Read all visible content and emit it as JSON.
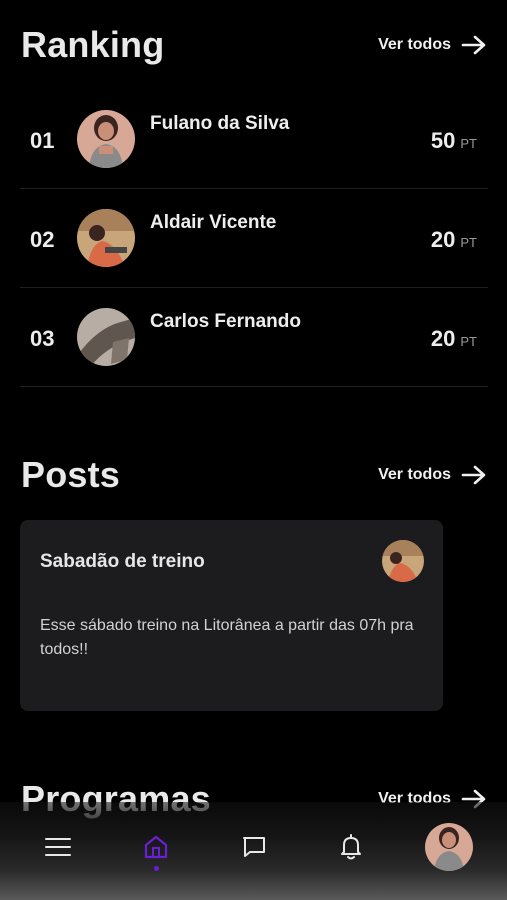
{
  "ranking": {
    "title": "Ranking",
    "see_all": "Ver todos",
    "items": [
      {
        "position": "01",
        "name": "Fulano da Silva",
        "points": "50",
        "unit": "PT"
      },
      {
        "position": "02",
        "name": "Aldair Vicente",
        "points": "20",
        "unit": "PT"
      },
      {
        "position": "03",
        "name": "Carlos Fernando",
        "points": "20",
        "unit": "PT"
      }
    ]
  },
  "posts": {
    "title": "Posts",
    "see_all": "Ver todos",
    "card": {
      "title": "Sabadão de treino",
      "body": "Esse sábado treino na Litorânea a partir das 07h pra todos!!"
    }
  },
  "programas": {
    "title": "Programas",
    "see_all": "Ver todos"
  },
  "tabbar": {
    "items": [
      "menu-icon",
      "home-icon",
      "chat-icon",
      "bell-icon",
      "profile-avatar"
    ],
    "active": "home-icon",
    "active_color": "#6a1fd6"
  },
  "colors": {
    "background": "#000000",
    "card": "#1c1c1e",
    "accent": "#6a1fd6"
  }
}
